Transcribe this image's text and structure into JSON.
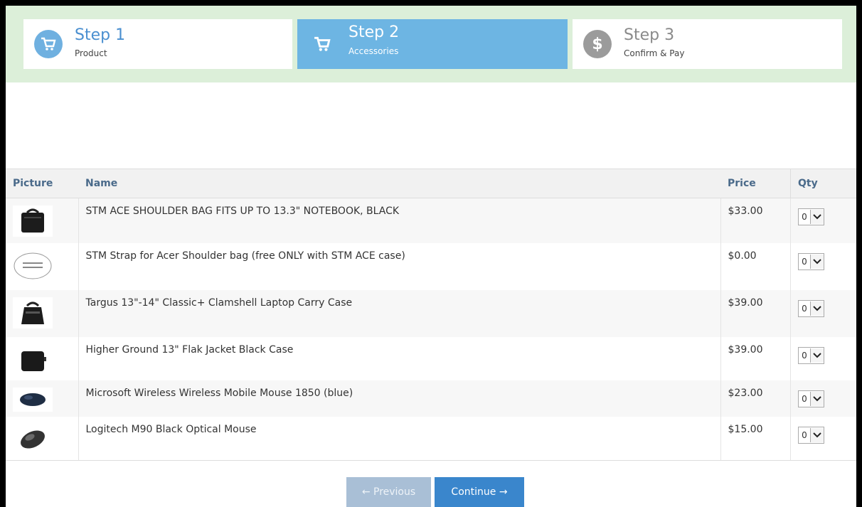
{
  "steps": [
    {
      "title": "Step 1",
      "sub": "Product",
      "icon": "cart-icon"
    },
    {
      "title": "Step 2",
      "sub": "Accessories",
      "icon": "cart-icon"
    },
    {
      "title": "Step 3",
      "sub": "Confirm & Pay",
      "icon": "dollar-icon",
      "glyph": "$"
    }
  ],
  "table": {
    "headers": {
      "picture": "Picture",
      "name": "Name",
      "price": "Price",
      "qty": "Qty"
    },
    "rows": [
      {
        "name": "STM ACE SHOULDER BAG FITS UP TO 13.3\" NOTEBOOK, BLACK",
        "price": "$33.00",
        "qty": "0",
        "image": "shoulder-bag-image"
      },
      {
        "name": "STM Strap for Acer Shoulder bag (free ONLY with STM ACE case)",
        "price": "$0.00",
        "qty": "0",
        "image": "no-image-placeholder"
      },
      {
        "name": "Targus 13\"-14\" Classic+ Clamshell Laptop Carry Case",
        "price": "$39.00",
        "qty": "0",
        "image": "laptop-case-image"
      },
      {
        "name": "Higher Ground 13\" Flak Jacket Black Case",
        "price": "$39.00",
        "qty": "0",
        "image": "sleeve-case-image"
      },
      {
        "name": "Microsoft Wireless Wireless Mobile Mouse 1850 (blue)",
        "price": "$23.00",
        "qty": "0",
        "image": "blue-mouse-image"
      },
      {
        "name": "Logitech M90 Black Optical Mouse",
        "price": "$15.00",
        "qty": "0",
        "image": "black-mouse-image"
      }
    ]
  },
  "buttons": {
    "previous": "← Previous",
    "continue": "Continue →"
  },
  "colors": {
    "steps_bar": "#dcefd9",
    "active_step": "#6db5e3",
    "accent": "#3a86cc"
  }
}
